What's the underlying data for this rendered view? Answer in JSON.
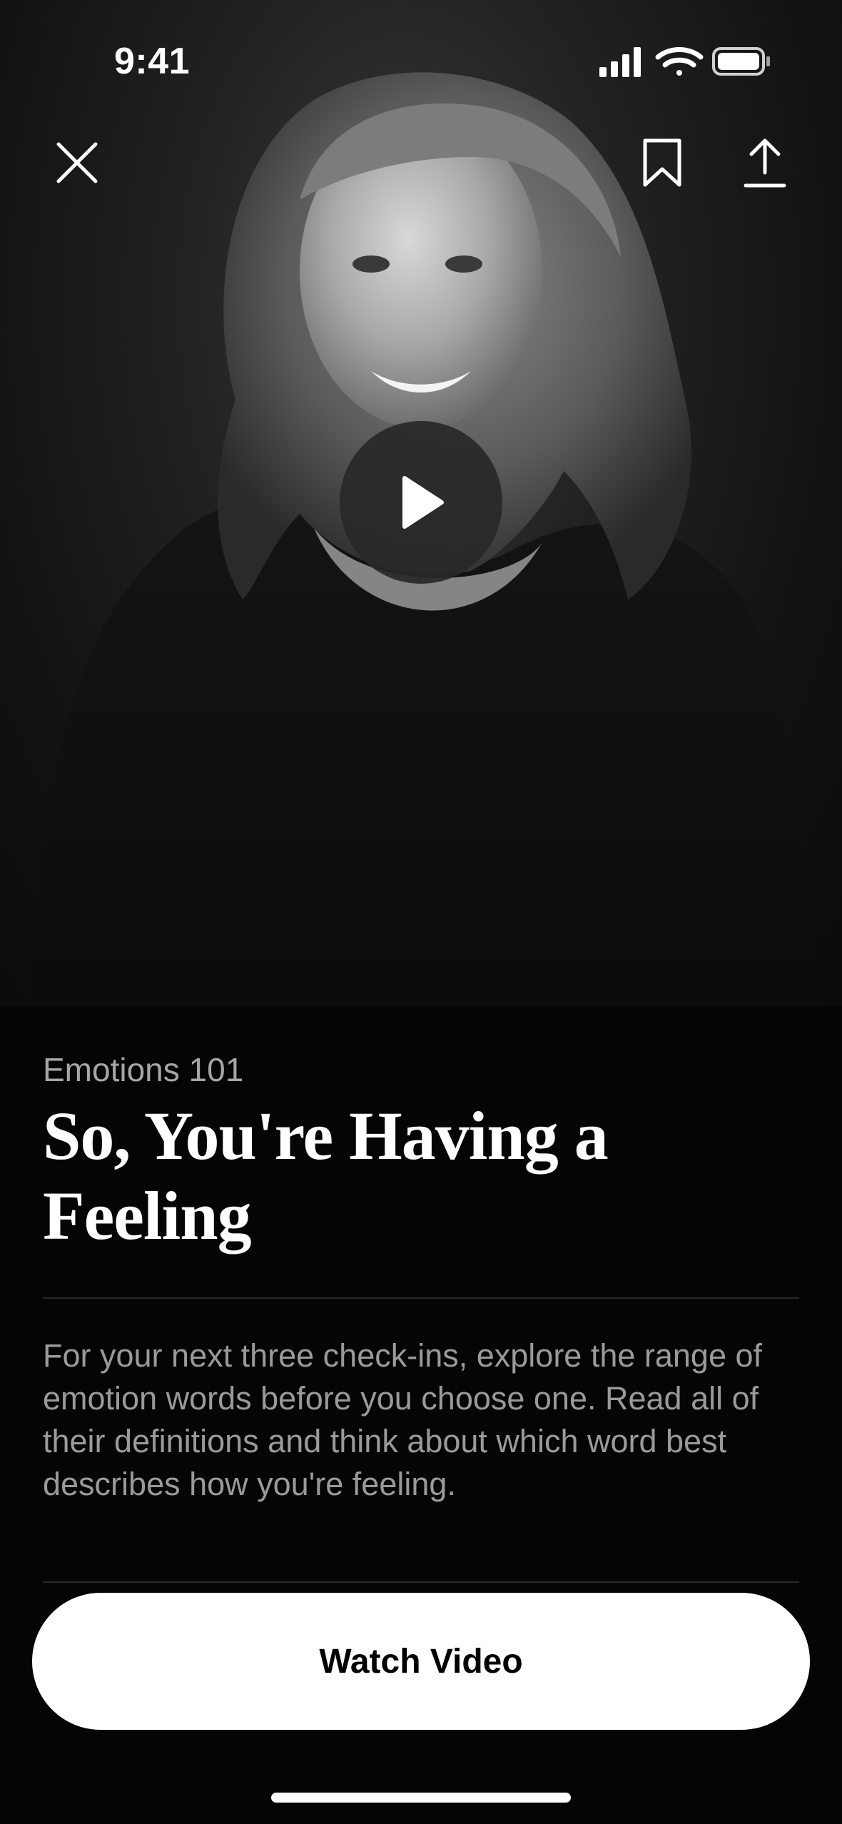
{
  "status_bar": {
    "time": "9:41",
    "icons": [
      "cellular-signal-icon",
      "wifi-icon",
      "battery-icon"
    ]
  },
  "header": {
    "close_icon": "close-icon",
    "bookmark_icon": "bookmark-icon",
    "share_icon": "share-icon"
  },
  "video": {
    "play_icon": "play-icon"
  },
  "lesson": {
    "category": "Emotions 101",
    "title": "So, You're Having a Feeling",
    "description": "For your next three check-ins, explore the range of emotion words before you choose one. Read all of their definitions and think about which word best describes how you're feeling."
  },
  "cta": {
    "label": "Watch Video"
  },
  "colors": {
    "background": "#050505",
    "primary_text": "#ffffff",
    "secondary_text": "#a6a6a6",
    "button_bg": "#ffffff",
    "button_text": "#000000"
  }
}
